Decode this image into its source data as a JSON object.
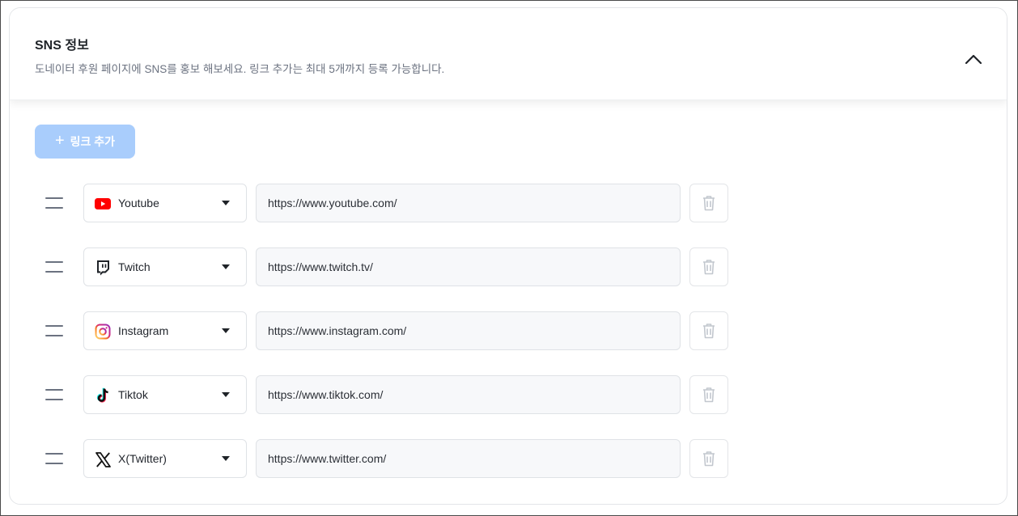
{
  "section": {
    "title": "SNS 정보",
    "description": "도네이터 후원 페이지에 SNS를 홍보 해보세요. 링크 추가는 최대 5개까지 등록 가능합니다."
  },
  "add_button": {
    "label": "링크 추가"
  },
  "links": [
    {
      "platform": "Youtube",
      "icon": "youtube-icon",
      "url": "https://www.youtube.com/"
    },
    {
      "platform": "Twitch",
      "icon": "twitch-icon",
      "url": "https://www.twitch.tv/"
    },
    {
      "platform": "Instagram",
      "icon": "instagram-icon",
      "url": "https://www.instagram.com/"
    },
    {
      "platform": "Tiktok",
      "icon": "tiktok-icon",
      "url": "https://www.tiktok.com/"
    },
    {
      "platform": "X(Twitter)",
      "icon": "x-twitter-icon",
      "url": "https://www.twitter.com/"
    }
  ],
  "colors": {
    "add_button_bg": "#a9cdfc",
    "youtube_red": "#ff0000",
    "input_bg": "#f7f8fa"
  }
}
